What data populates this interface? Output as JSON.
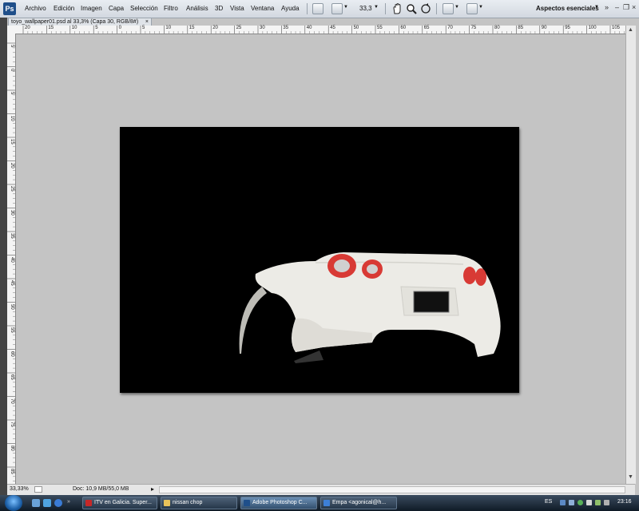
{
  "app": {
    "logo": "Ps",
    "menus": [
      "Archivo",
      "Edición",
      "Imagen",
      "Capa",
      "Selección",
      "Filtro",
      "Análisis",
      "3D",
      "Vista",
      "Ventana",
      "Ayuda"
    ],
    "zoom_value": "33,3",
    "workspace": "Aspectos esenciales",
    "workspace_arrow": "▼",
    "controls": {
      "chevron": "»",
      "minimize": "–",
      "restore": "❐",
      "close": "×"
    }
  },
  "document": {
    "tab_label": "toyo_wallpaper01.psd al 33,3% (Capa 30, RGB/8#)",
    "close_glyph": "×"
  },
  "rulers": {
    "top": [
      "20",
      "15",
      "10",
      "5",
      "0",
      "5",
      "10",
      "15",
      "20",
      "25",
      "30",
      "35",
      "40",
      "45",
      "50",
      "55",
      "60",
      "65",
      "70",
      "75",
      "80",
      "85",
      "90",
      "95",
      "100",
      "105"
    ],
    "left": [
      "5",
      "0",
      "5",
      "10",
      "15",
      "20",
      "25",
      "30",
      "35",
      "40",
      "45",
      "50",
      "55",
      "60",
      "65",
      "70",
      "75",
      "80",
      "85",
      "90",
      "95"
    ]
  },
  "status": {
    "zoom": "33,33%",
    "doc_size": "Doc: 10,9 MB/55,0 MB",
    "arrow": "▸"
  },
  "taskbar": {
    "items": [
      {
        "label": "ITV en Galicia. Super...",
        "icon_color": "#c62828",
        "active": false
      },
      {
        "label": "nissan chop",
        "icon_color": "#e8c25a",
        "active": false
      },
      {
        "label": "Adobe Photoshop C...",
        "icon_color": "#1f4f8a",
        "active": true
      },
      {
        "label": "Empa <agonical@h...",
        "icon_color": "#3d7fd6",
        "active": false
      }
    ],
    "language": "ES",
    "clock": "23:16"
  },
  "colors": {
    "canvas": "#000000",
    "car_body": "#ecebe6",
    "tail_light": "#d83a35"
  }
}
